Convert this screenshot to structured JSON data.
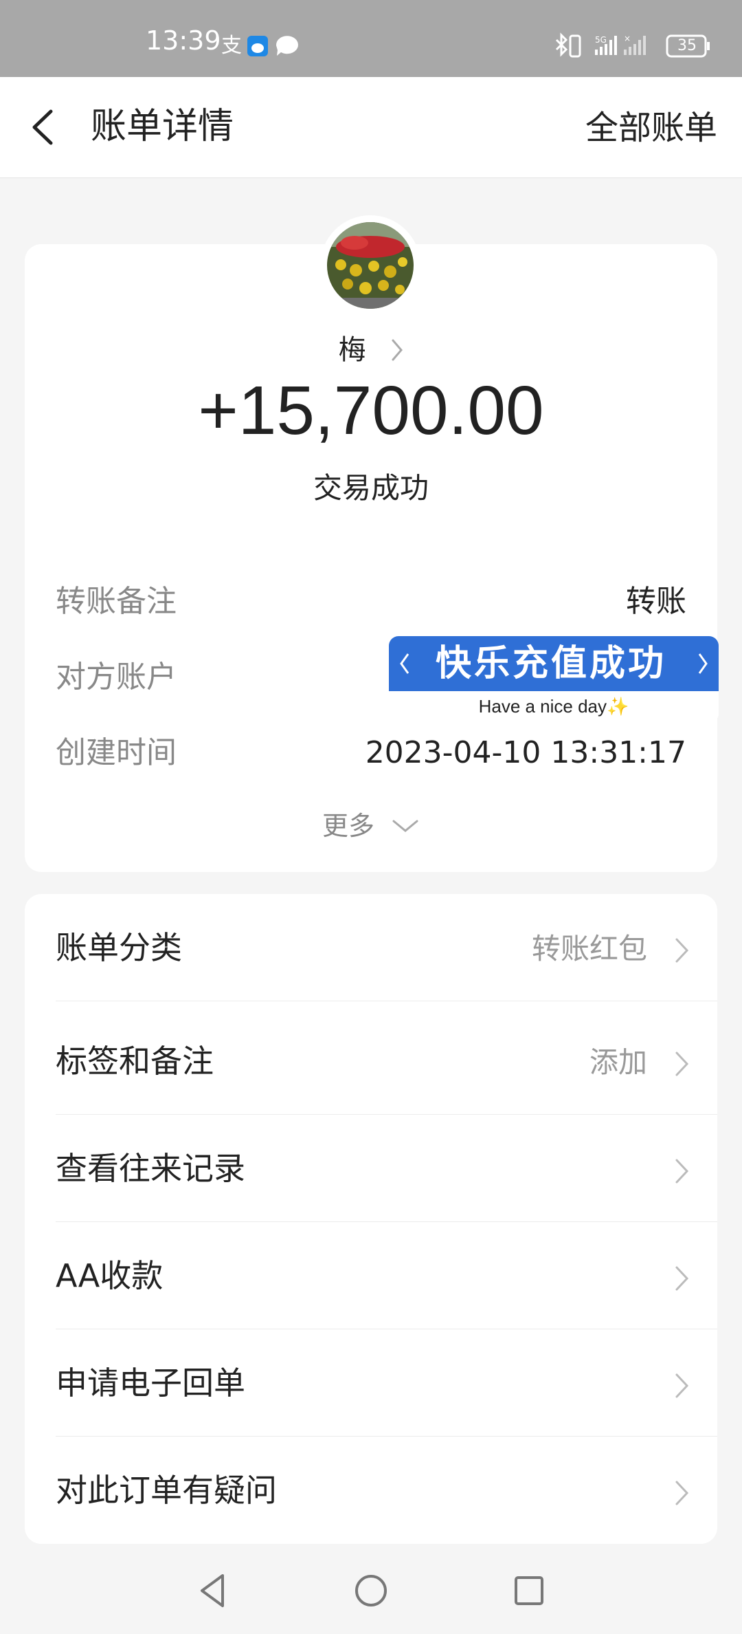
{
  "status_bar": {
    "time": "13:39",
    "battery": "35",
    "icons": [
      "alipay-icon",
      "weibo-icon",
      "chat-icon",
      "bluetooth-icon",
      "vibrate-icon",
      "5g-signal-icon",
      "signal-no-service-icon",
      "battery-icon"
    ]
  },
  "header": {
    "title": "账单详情",
    "right_link": "全部账单"
  },
  "transaction": {
    "payer_name": "梅",
    "amount": "+15,700.00",
    "status": "交易成功",
    "details": [
      {
        "label": "转账备注",
        "value": "转账"
      },
      {
        "label": "对方账户",
        "value": ""
      },
      {
        "label": "创建时间",
        "value": "2023-04-10 13:31:17"
      }
    ],
    "more_label": "更多"
  },
  "sticker": {
    "title": "快乐充值成功",
    "subtitle": "Have a nice day✨"
  },
  "menu": [
    {
      "label": "账单分类",
      "value": "转账红包"
    },
    {
      "label": "标签和备注",
      "value": "添加"
    },
    {
      "label": "查看往来记录",
      "value": ""
    },
    {
      "label": "AA收款",
      "value": ""
    },
    {
      "label": "申请电子回单",
      "value": ""
    },
    {
      "label": "对此订单有疑问",
      "value": ""
    }
  ],
  "colors": {
    "status_bar": "#a8a8a8",
    "sticker_blue": "#2f6fd6",
    "text_primary": "#222222",
    "text_secondary": "#888888"
  }
}
